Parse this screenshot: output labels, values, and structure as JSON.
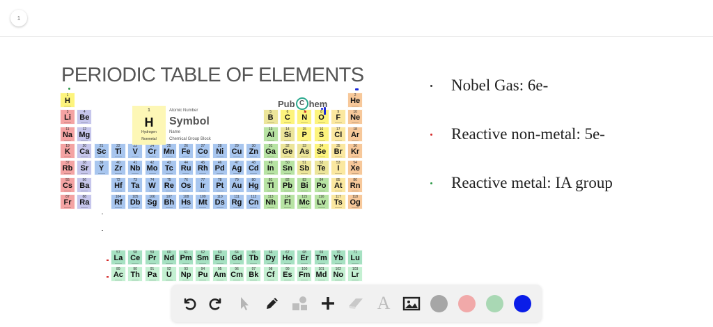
{
  "page": {
    "number": "1"
  },
  "slide": {
    "title": "PERIODIC TABLE OF ELEMENTS",
    "brand": {
      "before": "Pub",
      "letter": "C",
      "after": "hem"
    },
    "legend": {
      "number": "1",
      "symbol": "H",
      "name": "Hydrogen",
      "group": "Nonmetal",
      "key_number": "Atomic Number",
      "key_symbol": "Symbol",
      "key_name": "Name",
      "key_group": "Chemical Group Block"
    },
    "bullets": [
      {
        "text": "Nobel Gas: 6e-",
        "dot_color": "#333333"
      },
      {
        "text": "Reactive non-metal: 5e-",
        "dot_color": "#d62a2a"
      },
      {
        "text": "Reactive metal: IA group",
        "dot_color": "#2e9a48"
      }
    ]
  },
  "element_colors": {
    "alkali": "#f4a3a3",
    "alkaline": "#c6c6ec",
    "transition": "#a8c6ef",
    "poor": "#b7e3a3",
    "metalloid": "#ece59a",
    "nonmetal": "#fdf47d",
    "halogen": "#fbe8a0",
    "noble": "#f7c89a",
    "lanthanide": "#a6e1c2",
    "actinide": "#c4f0d2"
  },
  "elements": [
    {
      "num": "1",
      "sym": "H",
      "row": 1,
      "col": 1,
      "cat": "nonmetal"
    },
    {
      "num": "2",
      "sym": "He",
      "row": 1,
      "col": 18,
      "cat": "noble"
    },
    {
      "num": "3",
      "sym": "Li",
      "row": 2,
      "col": 1,
      "cat": "alkali"
    },
    {
      "num": "4",
      "sym": "Be",
      "row": 2,
      "col": 2,
      "cat": "alkaline"
    },
    {
      "num": "5",
      "sym": "B",
      "row": 2,
      "col": 13,
      "cat": "metalloid"
    },
    {
      "num": "6",
      "sym": "C",
      "row": 2,
      "col": 14,
      "cat": "nonmetal"
    },
    {
      "num": "7",
      "sym": "N",
      "row": 2,
      "col": 15,
      "cat": "nonmetal"
    },
    {
      "num": "8",
      "sym": "O",
      "row": 2,
      "col": 16,
      "cat": "nonmetal"
    },
    {
      "num": "9",
      "sym": "F",
      "row": 2,
      "col": 17,
      "cat": "halogen"
    },
    {
      "num": "10",
      "sym": "Ne",
      "row": 2,
      "col": 18,
      "cat": "noble"
    },
    {
      "num": "11",
      "sym": "Na",
      "row": 3,
      "col": 1,
      "cat": "alkali"
    },
    {
      "num": "12",
      "sym": "Mg",
      "row": 3,
      "col": 2,
      "cat": "alkaline"
    },
    {
      "num": "13",
      "sym": "Al",
      "row": 3,
      "col": 13,
      "cat": "poor"
    },
    {
      "num": "14",
      "sym": "Si",
      "row": 3,
      "col": 14,
      "cat": "metalloid"
    },
    {
      "num": "15",
      "sym": "P",
      "row": 3,
      "col": 15,
      "cat": "nonmetal"
    },
    {
      "num": "16",
      "sym": "S",
      "row": 3,
      "col": 16,
      "cat": "nonmetal"
    },
    {
      "num": "17",
      "sym": "Cl",
      "row": 3,
      "col": 17,
      "cat": "halogen"
    },
    {
      "num": "18",
      "sym": "Ar",
      "row": 3,
      "col": 18,
      "cat": "noble"
    },
    {
      "num": "19",
      "sym": "K",
      "row": 4,
      "col": 1,
      "cat": "alkali"
    },
    {
      "num": "20",
      "sym": "Ca",
      "row": 4,
      "col": 2,
      "cat": "alkaline"
    },
    {
      "num": "21",
      "sym": "Sc",
      "row": 4,
      "col": 3,
      "cat": "transition"
    },
    {
      "num": "22",
      "sym": "Ti",
      "row": 4,
      "col": 4,
      "cat": "transition"
    },
    {
      "num": "23",
      "sym": "V",
      "row": 4,
      "col": 5,
      "cat": "transition"
    },
    {
      "num": "24",
      "sym": "Cr",
      "row": 4,
      "col": 6,
      "cat": "transition"
    },
    {
      "num": "25",
      "sym": "Mn",
      "row": 4,
      "col": 7,
      "cat": "transition"
    },
    {
      "num": "26",
      "sym": "Fe",
      "row": 4,
      "col": 8,
      "cat": "transition"
    },
    {
      "num": "27",
      "sym": "Co",
      "row": 4,
      "col": 9,
      "cat": "transition"
    },
    {
      "num": "28",
      "sym": "Ni",
      "row": 4,
      "col": 10,
      "cat": "transition"
    },
    {
      "num": "29",
      "sym": "Cu",
      "row": 4,
      "col": 11,
      "cat": "transition"
    },
    {
      "num": "30",
      "sym": "Zn",
      "row": 4,
      "col": 12,
      "cat": "transition"
    },
    {
      "num": "31",
      "sym": "Ga",
      "row": 4,
      "col": 13,
      "cat": "poor"
    },
    {
      "num": "32",
      "sym": "Ge",
      "row": 4,
      "col": 14,
      "cat": "metalloid"
    },
    {
      "num": "33",
      "sym": "As",
      "row": 4,
      "col": 15,
      "cat": "metalloid"
    },
    {
      "num": "34",
      "sym": "Se",
      "row": 4,
      "col": 16,
      "cat": "nonmetal"
    },
    {
      "num": "35",
      "sym": "Br",
      "row": 4,
      "col": 17,
      "cat": "halogen"
    },
    {
      "num": "36",
      "sym": "Kr",
      "row": 4,
      "col": 18,
      "cat": "noble"
    },
    {
      "num": "37",
      "sym": "Rb",
      "row": 5,
      "col": 1,
      "cat": "alkali"
    },
    {
      "num": "38",
      "sym": "Sr",
      "row": 5,
      "col": 2,
      "cat": "alkaline"
    },
    {
      "num": "39",
      "sym": "Y",
      "row": 5,
      "col": 3,
      "cat": "transition"
    },
    {
      "num": "40",
      "sym": "Zr",
      "row": 5,
      "col": 4,
      "cat": "transition"
    },
    {
      "num": "41",
      "sym": "Nb",
      "row": 5,
      "col": 5,
      "cat": "transition"
    },
    {
      "num": "42",
      "sym": "Mo",
      "row": 5,
      "col": 6,
      "cat": "transition"
    },
    {
      "num": "43",
      "sym": "Tc",
      "row": 5,
      "col": 7,
      "cat": "transition"
    },
    {
      "num": "44",
      "sym": "Ru",
      "row": 5,
      "col": 8,
      "cat": "transition"
    },
    {
      "num": "45",
      "sym": "Rh",
      "row": 5,
      "col": 9,
      "cat": "transition"
    },
    {
      "num": "46",
      "sym": "Pd",
      "row": 5,
      "col": 10,
      "cat": "transition"
    },
    {
      "num": "47",
      "sym": "Ag",
      "row": 5,
      "col": 11,
      "cat": "transition"
    },
    {
      "num": "48",
      "sym": "Cd",
      "row": 5,
      "col": 12,
      "cat": "transition"
    },
    {
      "num": "49",
      "sym": "In",
      "row": 5,
      "col": 13,
      "cat": "poor"
    },
    {
      "num": "50",
      "sym": "Sn",
      "row": 5,
      "col": 14,
      "cat": "poor"
    },
    {
      "num": "51",
      "sym": "Sb",
      "row": 5,
      "col": 15,
      "cat": "metalloid"
    },
    {
      "num": "52",
      "sym": "Te",
      "row": 5,
      "col": 16,
      "cat": "metalloid"
    },
    {
      "num": "53",
      "sym": "I",
      "row": 5,
      "col": 17,
      "cat": "halogen"
    },
    {
      "num": "54",
      "sym": "Xe",
      "row": 5,
      "col": 18,
      "cat": "noble"
    },
    {
      "num": "55",
      "sym": "Cs",
      "row": 6,
      "col": 1,
      "cat": "alkali"
    },
    {
      "num": "56",
      "sym": "Ba",
      "row": 6,
      "col": 2,
      "cat": "alkaline"
    },
    {
      "num": "72",
      "sym": "Hf",
      "row": 6,
      "col": 4,
      "cat": "transition"
    },
    {
      "num": "73",
      "sym": "Ta",
      "row": 6,
      "col": 5,
      "cat": "transition"
    },
    {
      "num": "74",
      "sym": "W",
      "row": 6,
      "col": 6,
      "cat": "transition"
    },
    {
      "num": "75",
      "sym": "Re",
      "row": 6,
      "col": 7,
      "cat": "transition"
    },
    {
      "num": "76",
      "sym": "Os",
      "row": 6,
      "col": 8,
      "cat": "transition"
    },
    {
      "num": "77",
      "sym": "Ir",
      "row": 6,
      "col": 9,
      "cat": "transition"
    },
    {
      "num": "78",
      "sym": "Pt",
      "row": 6,
      "col": 10,
      "cat": "transition"
    },
    {
      "num": "79",
      "sym": "Au",
      "row": 6,
      "col": 11,
      "cat": "transition"
    },
    {
      "num": "80",
      "sym": "Hg",
      "row": 6,
      "col": 12,
      "cat": "transition"
    },
    {
      "num": "81",
      "sym": "Tl",
      "row": 6,
      "col": 13,
      "cat": "poor"
    },
    {
      "num": "82",
      "sym": "Pb",
      "row": 6,
      "col": 14,
      "cat": "poor"
    },
    {
      "num": "83",
      "sym": "Bi",
      "row": 6,
      "col": 15,
      "cat": "poor"
    },
    {
      "num": "84",
      "sym": "Po",
      "row": 6,
      "col": 16,
      "cat": "poor"
    },
    {
      "num": "85",
      "sym": "At",
      "row": 6,
      "col": 17,
      "cat": "halogen"
    },
    {
      "num": "86",
      "sym": "Rn",
      "row": 6,
      "col": 18,
      "cat": "noble"
    },
    {
      "num": "87",
      "sym": "Fr",
      "row": 7,
      "col": 1,
      "cat": "alkali"
    },
    {
      "num": "88",
      "sym": "Ra",
      "row": 7,
      "col": 2,
      "cat": "alkaline"
    },
    {
      "num": "104",
      "sym": "Rf",
      "row": 7,
      "col": 4,
      "cat": "transition"
    },
    {
      "num": "105",
      "sym": "Db",
      "row": 7,
      "col": 5,
      "cat": "transition"
    },
    {
      "num": "106",
      "sym": "Sg",
      "row": 7,
      "col": 6,
      "cat": "transition"
    },
    {
      "num": "107",
      "sym": "Bh",
      "row": 7,
      "col": 7,
      "cat": "transition"
    },
    {
      "num": "108",
      "sym": "Hs",
      "row": 7,
      "col": 8,
      "cat": "transition"
    },
    {
      "num": "109",
      "sym": "Mt",
      "row": 7,
      "col": 9,
      "cat": "transition"
    },
    {
      "num": "110",
      "sym": "Ds",
      "row": 7,
      "col": 10,
      "cat": "transition"
    },
    {
      "num": "111",
      "sym": "Rg",
      "row": 7,
      "col": 11,
      "cat": "transition"
    },
    {
      "num": "112",
      "sym": "Cn",
      "row": 7,
      "col": 12,
      "cat": "transition"
    },
    {
      "num": "113",
      "sym": "Nh",
      "row": 7,
      "col": 13,
      "cat": "poor"
    },
    {
      "num": "114",
      "sym": "Fl",
      "row": 7,
      "col": 14,
      "cat": "poor"
    },
    {
      "num": "115",
      "sym": "Mc",
      "row": 7,
      "col": 15,
      "cat": "poor"
    },
    {
      "num": "116",
      "sym": "Lv",
      "row": 7,
      "col": 16,
      "cat": "poor"
    },
    {
      "num": "117",
      "sym": "Ts",
      "row": 7,
      "col": 17,
      "cat": "halogen"
    },
    {
      "num": "118",
      "sym": "Og",
      "row": 7,
      "col": 18,
      "cat": "noble"
    },
    {
      "num": "57",
      "sym": "La",
      "row": 9,
      "col": 4,
      "cat": "lanthanide"
    },
    {
      "num": "58",
      "sym": "Ce",
      "row": 9,
      "col": 5,
      "cat": "lanthanide"
    },
    {
      "num": "59",
      "sym": "Pr",
      "row": 9,
      "col": 6,
      "cat": "lanthanide"
    },
    {
      "num": "60",
      "sym": "Nd",
      "row": 9,
      "col": 7,
      "cat": "lanthanide"
    },
    {
      "num": "61",
      "sym": "Pm",
      "row": 9,
      "col": 8,
      "cat": "lanthanide"
    },
    {
      "num": "62",
      "sym": "Sm",
      "row": 9,
      "col": 9,
      "cat": "lanthanide"
    },
    {
      "num": "63",
      "sym": "Eu",
      "row": 9,
      "col": 10,
      "cat": "lanthanide"
    },
    {
      "num": "64",
      "sym": "Gd",
      "row": 9,
      "col": 11,
      "cat": "lanthanide"
    },
    {
      "num": "65",
      "sym": "Tb",
      "row": 9,
      "col": 12,
      "cat": "lanthanide"
    },
    {
      "num": "66",
      "sym": "Dy",
      "row": 9,
      "col": 13,
      "cat": "lanthanide"
    },
    {
      "num": "67",
      "sym": "Ho",
      "row": 9,
      "col": 14,
      "cat": "lanthanide"
    },
    {
      "num": "68",
      "sym": "Er",
      "row": 9,
      "col": 15,
      "cat": "lanthanide"
    },
    {
      "num": "69",
      "sym": "Tm",
      "row": 9,
      "col": 16,
      "cat": "lanthanide"
    },
    {
      "num": "70",
      "sym": "Yb",
      "row": 9,
      "col": 17,
      "cat": "lanthanide"
    },
    {
      "num": "71",
      "sym": "Lu",
      "row": 9,
      "col": 18,
      "cat": "lanthanide"
    },
    {
      "num": "89",
      "sym": "Ac",
      "row": 10,
      "col": 4,
      "cat": "actinide"
    },
    {
      "num": "90",
      "sym": "Th",
      "row": 10,
      "col": 5,
      "cat": "actinide"
    },
    {
      "num": "91",
      "sym": "Pa",
      "row": 10,
      "col": 6,
      "cat": "actinide"
    },
    {
      "num": "92",
      "sym": "U",
      "row": 10,
      "col": 7,
      "cat": "actinide"
    },
    {
      "num": "93",
      "sym": "Np",
      "row": 10,
      "col": 8,
      "cat": "actinide"
    },
    {
      "num": "94",
      "sym": "Pu",
      "row": 10,
      "col": 9,
      "cat": "actinide"
    },
    {
      "num": "95",
      "sym": "Am",
      "row": 10,
      "col": 10,
      "cat": "actinide"
    },
    {
      "num": "96",
      "sym": "Cm",
      "row": 10,
      "col": 11,
      "cat": "actinide"
    },
    {
      "num": "97",
      "sym": "Bk",
      "row": 10,
      "col": 12,
      "cat": "actinide"
    },
    {
      "num": "98",
      "sym": "Cf",
      "row": 10,
      "col": 13,
      "cat": "actinide"
    },
    {
      "num": "99",
      "sym": "Es",
      "row": 10,
      "col": 14,
      "cat": "actinide"
    },
    {
      "num": "100",
      "sym": "Fm",
      "row": 10,
      "col": 15,
      "cat": "actinide"
    },
    {
      "num": "101",
      "sym": "Md",
      "row": 10,
      "col": 16,
      "cat": "actinide"
    },
    {
      "num": "102",
      "sym": "No",
      "row": 10,
      "col": 17,
      "cat": "actinide"
    },
    {
      "num": "103",
      "sym": "Lr",
      "row": 10,
      "col": 18,
      "cat": "actinide"
    }
  ],
  "toolbar": {
    "tools": [
      {
        "name": "undo-icon",
        "glyph": "undo",
        "active": true
      },
      {
        "name": "redo-icon",
        "glyph": "redo",
        "active": true
      },
      {
        "name": "select-arrow-icon",
        "glyph": "pointer",
        "active": false
      },
      {
        "name": "pen-icon",
        "glyph": "pen",
        "active": true
      },
      {
        "name": "shapes-icon",
        "glyph": "shapes",
        "active": false
      },
      {
        "name": "plus-icon",
        "glyph": "plus",
        "active": true
      },
      {
        "name": "eraser-icon",
        "glyph": "eraser",
        "active": false
      },
      {
        "name": "text-icon",
        "glyph": "text",
        "active": false
      },
      {
        "name": "image-icon",
        "glyph": "image",
        "active": true
      }
    ],
    "colors": [
      {
        "name": "gray",
        "hex": "#a6a6a6"
      },
      {
        "name": "pink",
        "hex": "#f1a9a9"
      },
      {
        "name": "green",
        "hex": "#a9d8b4"
      },
      {
        "name": "blue",
        "hex": "#0a1de8"
      }
    ]
  }
}
